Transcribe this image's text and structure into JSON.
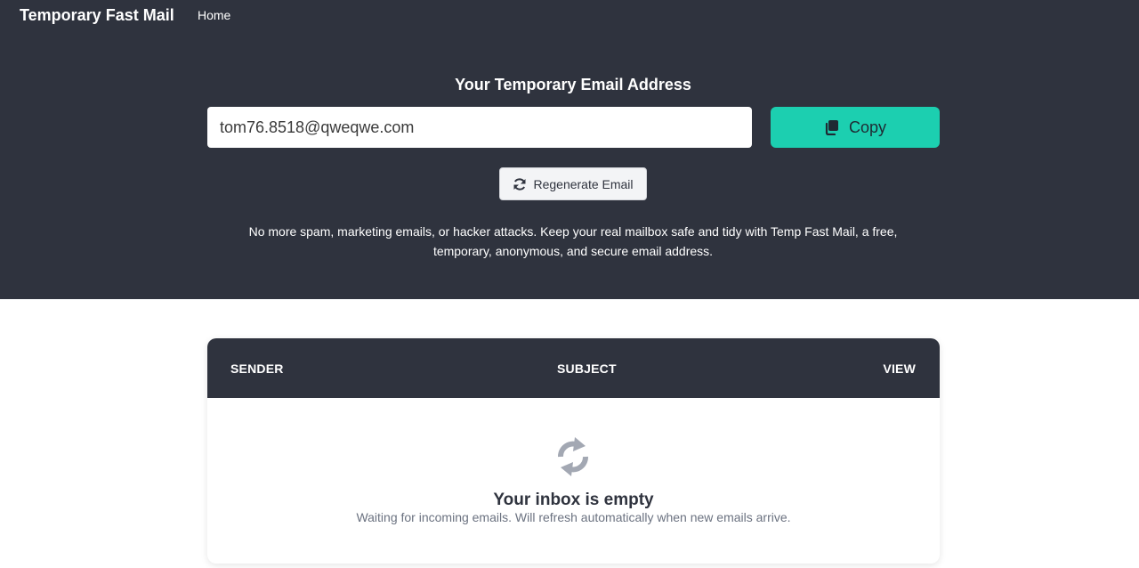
{
  "nav": {
    "brand": "Temporary Fast Mail",
    "home_link": "Home"
  },
  "hero": {
    "title": "Your Temporary Email Address",
    "email_value": "tom76.8518@qweqwe.com",
    "copy_label": "Copy",
    "copy_icon": "copy-icon",
    "regenerate_label": "Regenerate Email",
    "regenerate_icon": "refresh-icon",
    "description": "No more spam, marketing emails, or hacker attacks. Keep your real mailbox safe and tidy with Temp Fast Mail, a free, temporary, anonymous, and secure email address."
  },
  "inbox": {
    "columns": [
      "SENDER",
      "SUBJECT",
      "VIEW"
    ],
    "empty_icon": "refresh-icon",
    "empty_title": "Your inbox is empty",
    "empty_subtitle": "Waiting for incoming emails. Will refresh automatically when new emails arrive."
  },
  "colors": {
    "header_bg": "#2f333e",
    "accent": "#1ccfb0"
  }
}
